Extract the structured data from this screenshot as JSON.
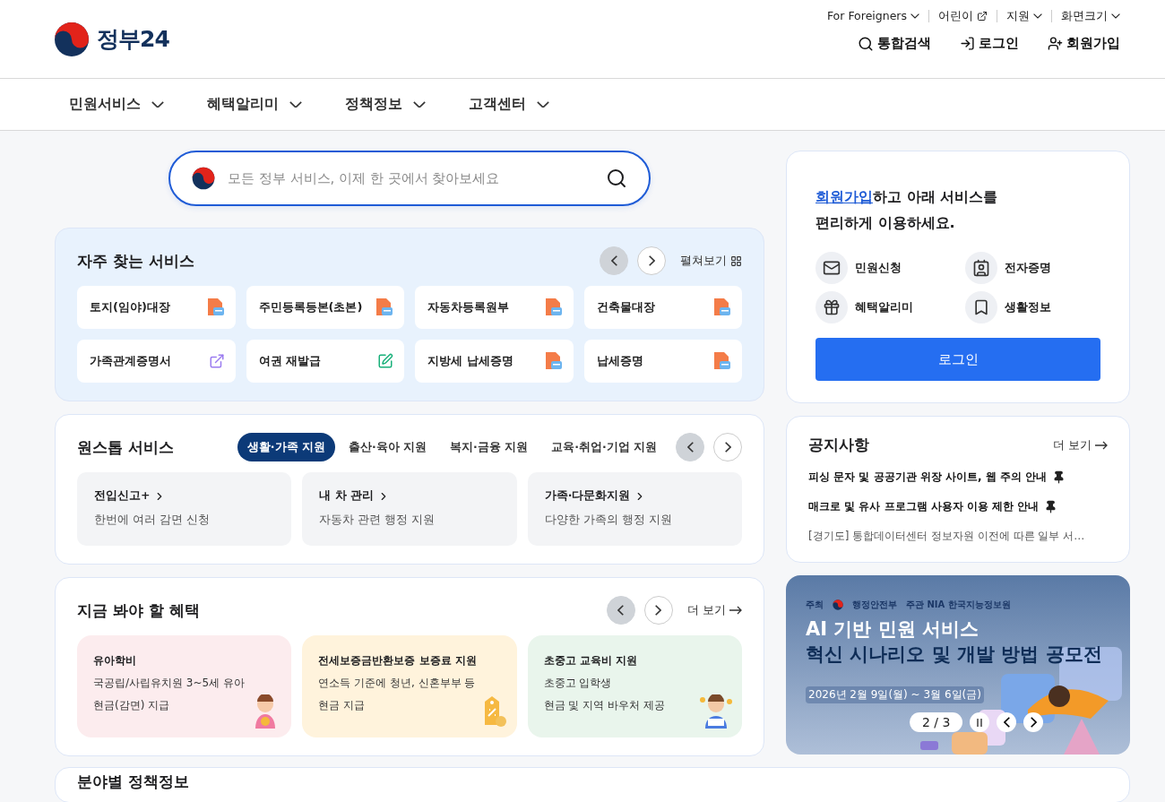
{
  "header": {
    "logo": "정부24",
    "utility_links": [
      {
        "label": "For Foreigners",
        "kind": "dropdown"
      },
      {
        "label": "어린이",
        "kind": "external"
      },
      {
        "label": "지원",
        "kind": "dropdown"
      },
      {
        "label": "화면크기",
        "kind": "dropdown"
      }
    ],
    "actions": [
      {
        "label": "통합검색",
        "kind": "search"
      },
      {
        "label": "로그인",
        "kind": "login"
      },
      {
        "label": "회원가입",
        "kind": "signup"
      }
    ]
  },
  "nav": [
    {
      "label": "민원서비스"
    },
    {
      "label": "혜택알리미"
    },
    {
      "label": "정책정보"
    },
    {
      "label": "고객센터"
    }
  ],
  "search": {
    "placeholder": "모든 정부 서비스, 이제 한 곳에서 찾아보세요"
  },
  "frequent": {
    "title": "자주 찾는 서비스",
    "prev_disabled": true,
    "expand_label": "펼쳐보기",
    "items": [
      {
        "label": "토지(임야)대장",
        "kind": "pdf"
      },
      {
        "label": "주민등록등본(초본)",
        "kind": "pdf"
      },
      {
        "label": "자동차등록원부",
        "kind": "pdf"
      },
      {
        "label": "건축물대장",
        "kind": "pdf"
      },
      {
        "label": "가족관계증명서",
        "kind": "external"
      },
      {
        "label": "여권 재발급",
        "kind": "edit"
      },
      {
        "label": "지방세 납세증명",
        "kind": "pdf"
      },
      {
        "label": "납세증명",
        "kind": "pdf"
      }
    ]
  },
  "onestop": {
    "title": "원스톱 서비스",
    "prev_disabled": true,
    "tabs": [
      {
        "label": "생활·가족 지원",
        "selected": true
      },
      {
        "label": "출산·육아 지원",
        "selected": false
      },
      {
        "label": "복지·금융 지원",
        "selected": false
      },
      {
        "label": "교육·취업·기업 지원",
        "selected": false
      }
    ],
    "cards": [
      {
        "title": "전입신고+",
        "desc": "한번에 여러 감면 신청"
      },
      {
        "title": "내 차 관리",
        "desc": "자동차 관련 행정 지원"
      },
      {
        "title": "가족·다문화지원",
        "desc": "다양한 가족의 행정 지원"
      }
    ]
  },
  "benefits": {
    "title": "지금 봐야 할 혜택",
    "prev_disabled": true,
    "more": "더 보기",
    "cards": [
      {
        "title": "유아학비",
        "lines": [
          "국공립/사립유치원 3~5세 유아",
          "현금(감면) 지급"
        ],
        "color": "#fcecee",
        "kind": "figure"
      },
      {
        "title": "전세보증금반환보증 보증료 지원",
        "lines": [
          "연소득 기준에 청년, 신혼부부 등",
          "현금 지급"
        ],
        "color": "#fff3dc",
        "kind": "tag"
      },
      {
        "title": "초중고 교육비 지원",
        "lines": [
          "초중고 입학생",
          "현금 및 지역 바우처 제공"
        ],
        "color": "#e9f5ec",
        "kind": "reader"
      }
    ]
  },
  "signup": {
    "link": "회원가입",
    "text": "하고 아래 서비스를 편리하게 이용하세요.",
    "items": [
      {
        "label": "민원신청",
        "kind": "mail"
      },
      {
        "label": "전자증명",
        "kind": "id"
      },
      {
        "label": "혜택알리미",
        "kind": "gift"
      },
      {
        "label": "생활정보",
        "kind": "bookmark"
      }
    ],
    "login_button": "로그인"
  },
  "notices": {
    "title": "공지사항",
    "more": "더 보기",
    "items": [
      {
        "text": "피싱 문자 및 공공기관 위장 사이트, 웹 주의 안내",
        "pinned": true
      },
      {
        "text": "매크로 및 유사 프로그램 사용자 이용 제한 안내",
        "pinned": true
      },
      {
        "text": "[경기도] 통합데이터센터 정보자원 이전에 따른 일부 서…",
        "pinned": false
      }
    ]
  },
  "banner": {
    "host": "주최",
    "host_name": "행정안전부",
    "organizer": "주관 NIA 한국지능정보원",
    "headline": [
      "AI 기반 민원 서비스",
      "혁신 시나리오 및 개발 방법 공모전"
    ],
    "date": "2026년 2월 9일(월) ~ 3월 6일(금)",
    "counter": "2 / 3",
    "paused": false
  },
  "policy": {
    "title": "분야별 정책정보"
  }
}
